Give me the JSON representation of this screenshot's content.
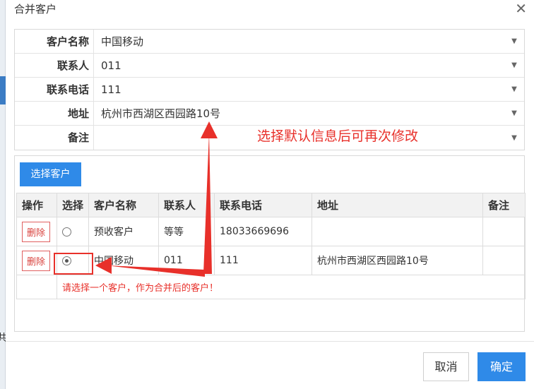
{
  "dialog": {
    "title": "合并客户",
    "close_glyph": "✕"
  },
  "form": {
    "rows": [
      {
        "label": "客户名称",
        "value": "中国移动"
      },
      {
        "label": "联系人",
        "value": "011"
      },
      {
        "label": "联系电话",
        "value": "111"
      },
      {
        "label": "地址",
        "value": "杭州市西湖区西园路10号"
      },
      {
        "label": "备注",
        "value": ""
      }
    ],
    "caret": "▼"
  },
  "annotation": {
    "text": "选择默认信息后可再次修改",
    "color": "#e8302a"
  },
  "grid": {
    "select_button": "选择客户",
    "columns": [
      "操作",
      "选择",
      "客户名称",
      "联系人",
      "联系电话",
      "地址",
      "备注"
    ],
    "rows": [
      {
        "action": "删除",
        "selected": false,
        "name": "预收客户",
        "contact": "等等",
        "phone": "18033669696",
        "address": "",
        "note": ""
      },
      {
        "action": "删除",
        "selected": true,
        "name": "中国移动",
        "contact": "011",
        "phone": "111",
        "address": "杭州市西湖区西园路10号",
        "note": ""
      }
    ],
    "hint": "请选择一个客户，作为合并后的客户！"
  },
  "footer": {
    "cancel": "取消",
    "ok": "确定"
  },
  "colors": {
    "primary": "#2f8ae8",
    "danger": "#e8302a"
  },
  "background": {
    "edge_char": "共"
  }
}
